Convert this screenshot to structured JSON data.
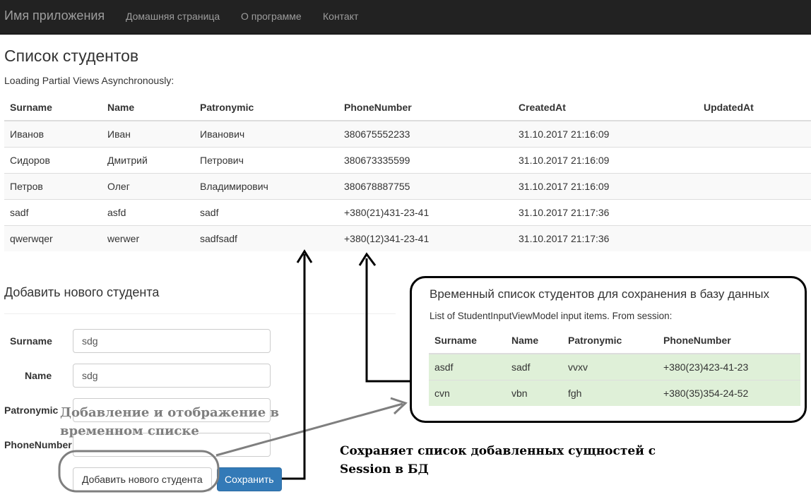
{
  "navbar": {
    "brand": "Имя приложения",
    "links": [
      "Домашняя страница",
      "О программе",
      "Контакт"
    ]
  },
  "page": {
    "title": "Список студентов",
    "subtitle": "Loading Partial Views Asynchronously:"
  },
  "students_table": {
    "columns": [
      "Surname",
      "Name",
      "Patronymic",
      "PhoneNumber",
      "CreatedAt",
      "UpdatedAt"
    ],
    "rows": [
      [
        "Иванов",
        "Иван",
        "Иванович",
        "380675552233",
        "31.10.2017 21:16:09",
        ""
      ],
      [
        "Сидоров",
        "Дмитрий",
        "Петрович",
        "380673335599",
        "31.10.2017 21:16:09",
        ""
      ],
      [
        "Петров",
        "Олег",
        "Владимирович",
        "380678887755",
        "31.10.2017 21:16:09",
        ""
      ],
      [
        "sadf",
        "asfd",
        "sadf",
        "+380(21)431-23-41",
        "31.10.2017 21:17:36",
        ""
      ],
      [
        "qwerwqer",
        "werwer",
        "sadfsadf",
        "+380(12)341-23-41",
        "31.10.2017 21:17:36",
        ""
      ]
    ]
  },
  "add_form": {
    "title": "Добавить нового студента",
    "fields": {
      "surname": {
        "label": "Surname",
        "value": "sdg"
      },
      "name": {
        "label": "Name",
        "value": "sdg"
      },
      "patronymic": {
        "label": "Patronymic",
        "value": ""
      },
      "phone": {
        "label": "PhoneNumber",
        "value": ""
      }
    },
    "add_button": "Добавить нового студента",
    "save_button": "Сохранить"
  },
  "temp_panel": {
    "title": "Временный список студентов для сохранения в базу данных",
    "subtitle": "List of StudentInputViewModel input items. From session:",
    "columns": [
      "Surname",
      "Name",
      "Patronymic",
      "PhoneNumber"
    ],
    "rows": [
      [
        "asdf",
        "sadf",
        "vvxv",
        "+380(23)423-41-23"
      ],
      [
        "cvn",
        "vbn",
        "fgh",
        "+380(35)354-24-52"
      ]
    ],
    "row_color": "#dff0d8"
  },
  "annotations": {
    "gray_note": "Добавление и отображение в временном списке",
    "black_note": "Сохраняет список добавленных сущностей с Session в БД"
  },
  "colors": {
    "navbar": "#222222",
    "primary": "#337ab7",
    "annotation_gray": "#7f7f7f"
  }
}
